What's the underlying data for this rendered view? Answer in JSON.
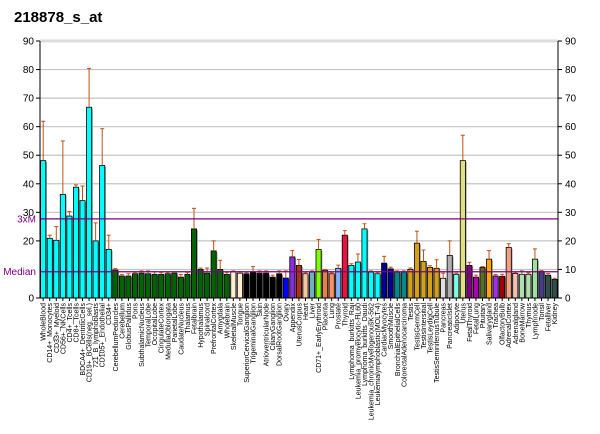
{
  "chart_data": {
    "type": "bar",
    "title": "218878_s_at",
    "xlabel": "",
    "ylabel": "",
    "ylim": [
      0,
      90
    ],
    "yticks_right": [
      0,
      10,
      20,
      30,
      40,
      50,
      60,
      70,
      80,
      90
    ],
    "yticks_left": [
      20,
      30,
      40,
      50,
      60,
      70,
      80,
      90
    ],
    "yticks_left_zero": "0",
    "grid": true,
    "reference_lines": [
      {
        "label": "Median",
        "value": 9.2,
        "color": "#800080"
      },
      {
        "label": "3xM",
        "value": 27.7,
        "color": "#800080"
      }
    ],
    "error_color": "#c05010",
    "categories": [
      "WholeBlood",
      "CD14+_Monocytes",
      "CD33+_Myeloid",
      "CD56+_NKCells",
      "CD4+_Tcells",
      "CD8+_Tcells",
      "BDCA4+_DentriticCells",
      "CD19+_BCells(neg._sel.)",
      "721_B_lymphoblasts",
      "CD105+_Endothelial",
      "CD34+",
      "CerebellumPeduncles",
      "Cerebellum",
      "GlobusPallidus",
      "Pons",
      "SubthalamicNucleus",
      "TemporalLobe",
      "OccipitalLobe",
      "CingulateCortex",
      "MedullaOblongata",
      "ParietalLobe",
      "CaudateNucleus",
      "Thalamus",
      "Fetalbrain",
      "Hypothalamus",
      "Spinalcord",
      "PrefrontalCortex",
      "Amygdala",
      "Wholebrain",
      "SkeletalMuscle",
      "Tongue",
      "SuperiorCervicalGanglion",
      "TrigeminalGanglion",
      "Skin",
      "AtrioventricularNode",
      "CiliaryGanglion",
      "DorsalRootGanglion",
      "Ovary",
      "Appendix",
      "UterusCorpus",
      "Heart",
      "Liver",
      "CD71+_EarlyErythroid",
      "Placenta",
      "Lung",
      "Prostate",
      "Thyroid",
      "Lymphoma_burkitts_Raji",
      "Leukemia_promyelocytic-HL60",
      "Lymphoma_burkitts_Daudi",
      "Leukemia_chronicMyelogenousK-562",
      "Leukemialymphoblastic(MOLT-4)",
      "CardiacMyocytes",
      "SmoothMuscle",
      "BronchialEpithelialCells",
      "ColorectalAdenocarcinoma",
      "Testis",
      "TestisGermCell",
      "TestisIntersitial",
      "TestisLeydigCell",
      "TestisSeminiferousTubule",
      "Pancreas",
      "PancreaticIslet",
      "Adipocyte",
      "Uterus",
      "FetalThyroid",
      "FetalLung",
      "Pituitary",
      "Salivarygland",
      "Trachea",
      "OlfactoryBulb",
      "AdrenalCortex",
      "Adrenalgland",
      "BoneMarrow",
      "Thymus",
      "Lymphnode",
      "Tonsil",
      "Fetalliver",
      "Kidney"
    ],
    "values": [
      48.1,
      20.9,
      20.2,
      36.3,
      28.7,
      38.8,
      34.1,
      66.8,
      20,
      46.4,
      17,
      9.8,
      7.7,
      7.7,
      8.5,
      8.7,
      8.5,
      8.3,
      8.3,
      8.5,
      8.7,
      7.3,
      8.3,
      24.2,
      10,
      8.7,
      16.5,
      10,
      8.3,
      9.2,
      8.7,
      8.5,
      9.2,
      8.7,
      8.7,
      7.3,
      8.5,
      7.0,
      14.4,
      11.4,
      8.5,
      9.1,
      17,
      9.7,
      8.5,
      10.4,
      22,
      11.4,
      12.6,
      24.2,
      9.1,
      8.5,
      12.2,
      10.2,
      9.1,
      9.1,
      10,
      19.2,
      12.8,
      10.7,
      10.4,
      6.9,
      14.9,
      8.3,
      48.1,
      11.4,
      7.3,
      10.7,
      13.6,
      7.7,
      7.6,
      17.7,
      8.6,
      8.3,
      8.3,
      13.6,
      9.3,
      8,
      6.5
    ],
    "error_tops": [
      61.9,
      22,
      25,
      55,
      30.3,
      39.6,
      39.2,
      80.4,
      26.3,
      59.3,
      22,
      10.3,
      8.2,
      8.5,
      9,
      9.5,
      9.5,
      9.2,
      9,
      9,
      9,
      8.2,
      9,
      31.4,
      10.5,
      10.5,
      20,
      13.2,
      9,
      9.5,
      9.2,
      9,
      11,
      9.5,
      9.5,
      8,
      9.5,
      9.5,
      16.6,
      13.5,
      9,
      9.5,
      20.5,
      10,
      9,
      11.5,
      23.6,
      12,
      15.4,
      26,
      9.5,
      9,
      14.6,
      10.8,
      9.5,
      9.5,
      10.5,
      23.4,
      16.8,
      11.3,
      13.4,
      8.7,
      20,
      8.7,
      57,
      12.5,
      8,
      11,
      16.6,
      8.2,
      8.3,
      19,
      9,
      9.5,
      8.8,
      17.2,
      9.6,
      8.6,
      6.9
    ],
    "colors": [
      "#00ffff",
      "#00ffff",
      "#00ffff",
      "#00ffff",
      "#00ffff",
      "#00ffff",
      "#00ffff",
      "#00ffff",
      "#00ffff",
      "#00ffff",
      "#00ffff",
      "#006400",
      "#006400",
      "#006400",
      "#006400",
      "#006400",
      "#006400",
      "#006400",
      "#006400",
      "#006400",
      "#006400",
      "#006400",
      "#006400",
      "#006400",
      "#006400",
      "#006400",
      "#006400",
      "#006400",
      "#006400",
      "#fff0d0",
      "#fff0d0",
      "#000000",
      "#000000",
      "#000000",
      "#000000",
      "#000000",
      "#000000",
      "#0000ff",
      "#8a2be2",
      "#b03020",
      "#f5c8a0",
      "#70b0b8",
      "#7fff00",
      "#e8804a",
      "#ff9060",
      "#80b0ff",
      "#ee1040",
      "#00ffff",
      "#00ffff",
      "#00ffff",
      "#00ffff",
      "#00ffff",
      "#000090",
      "#000090",
      "#008b8b",
      "#008b8b",
      "#d4a017",
      "#d4a017",
      "#d4a017",
      "#d4a017",
      "#d4a017",
      "#e0e0e0",
      "#b0b0b0",
      "#80ffe0",
      "#e0e080",
      "#800080",
      "#b000b0",
      "#557020",
      "#ffa500",
      "#a030e0",
      "#a00000",
      "#f4a080",
      "#f0c0b0",
      "#b0e0b0",
      "#b0e0b0",
      "#a0e0a0",
      "#483d8b",
      "#2f4f4f",
      "#2f4f4f"
    ]
  }
}
